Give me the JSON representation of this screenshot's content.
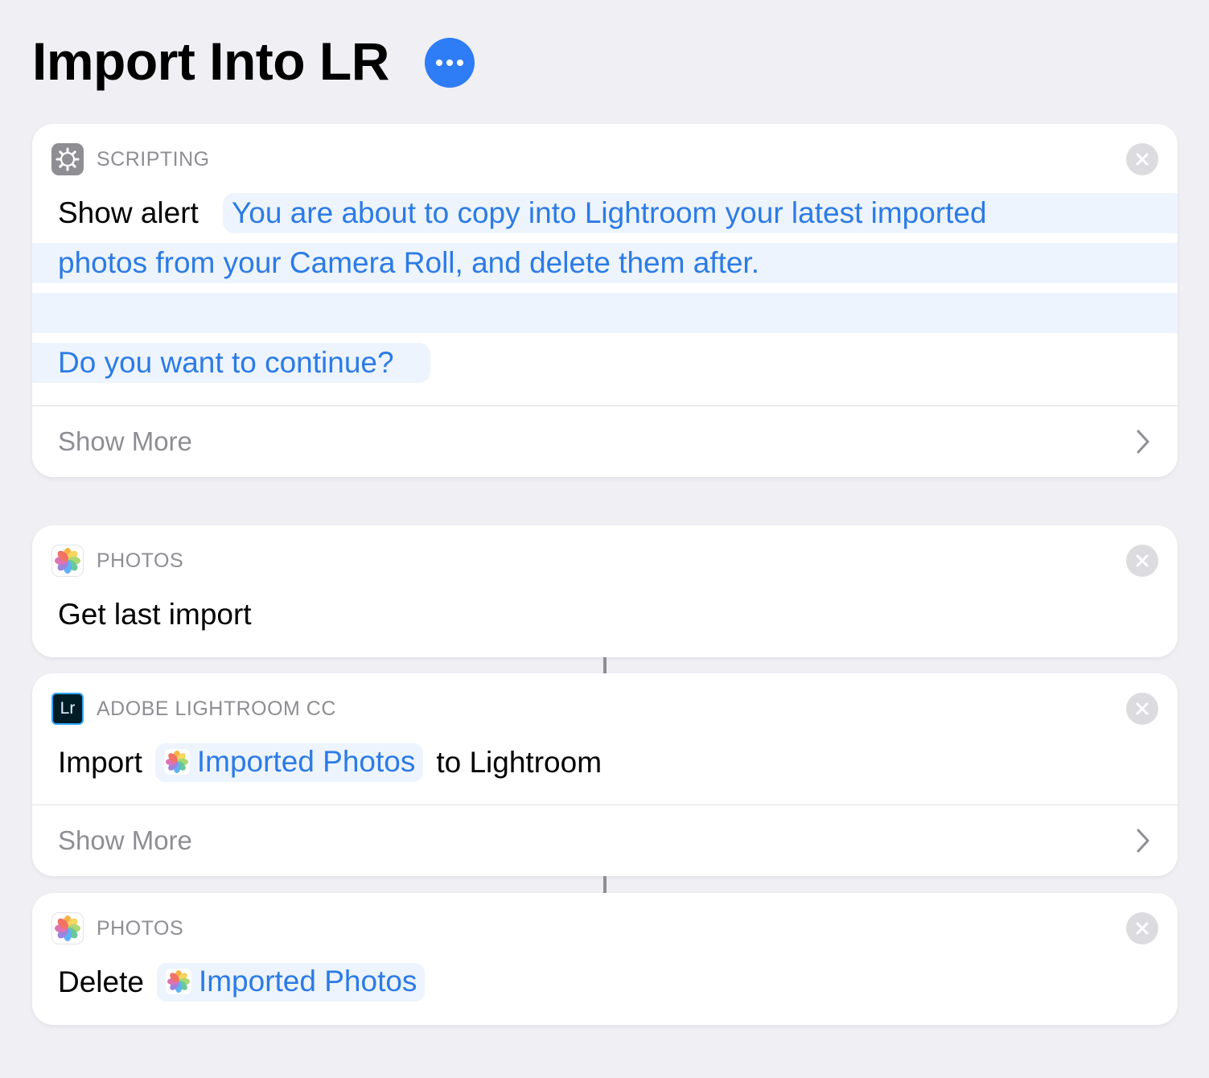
{
  "header": {
    "title": "Import Into LR",
    "more_icon": "ellipsis-icon",
    "accent": "#2e7cf6"
  },
  "actions": [
    {
      "app": "SCRIPTING",
      "icon": "gear-icon",
      "verb": "Show alert",
      "message_line1": "You are about to copy into Lightroom your latest imported",
      "message_line2": "photos from your Camera Roll, and delete them after.",
      "message_line4": "Do you want to continue?",
      "show_more": "Show More"
    },
    {
      "app": "PHOTOS",
      "icon": "photos-icon",
      "verb": "Get last import"
    },
    {
      "app": "ADOBE LIGHTROOM CC",
      "icon": "lightroom-icon",
      "icon_text": "Lr",
      "verb": "Import",
      "variable": "Imported Photos",
      "suffix": "to Lightroom",
      "show_more": "Show More"
    },
    {
      "app": "PHOTOS",
      "icon": "photos-icon",
      "verb": "Delete",
      "variable": "Imported Photos"
    }
  ],
  "colors": {
    "token_text": "#2b7be6",
    "token_bg": "#eef4fd",
    "background": "#efeff4"
  }
}
